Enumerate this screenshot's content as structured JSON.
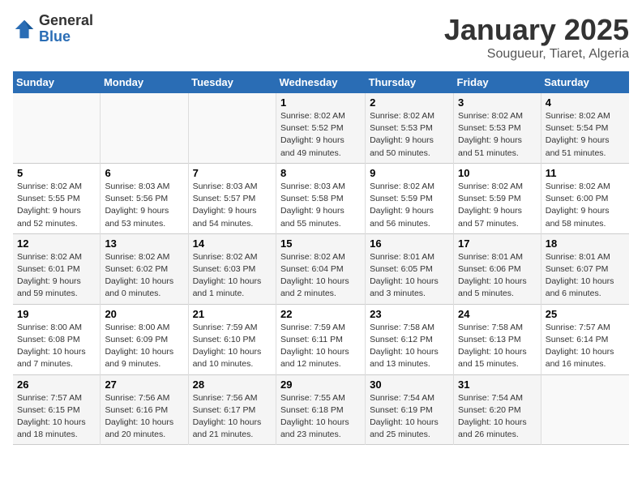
{
  "header": {
    "logo_general": "General",
    "logo_blue": "Blue",
    "calendar_title": "January 2025",
    "calendar_subtitle": "Sougueur, Tiaret, Algeria"
  },
  "weekdays": [
    "Sunday",
    "Monday",
    "Tuesday",
    "Wednesday",
    "Thursday",
    "Friday",
    "Saturday"
  ],
  "weeks": [
    [
      null,
      null,
      null,
      {
        "day": 1,
        "sunrise": "8:02 AM",
        "sunset": "5:52 PM",
        "daylight": "9 hours and 49 minutes."
      },
      {
        "day": 2,
        "sunrise": "8:02 AM",
        "sunset": "5:53 PM",
        "daylight": "9 hours and 50 minutes."
      },
      {
        "day": 3,
        "sunrise": "8:02 AM",
        "sunset": "5:53 PM",
        "daylight": "9 hours and 51 minutes."
      },
      {
        "day": 4,
        "sunrise": "8:02 AM",
        "sunset": "5:54 PM",
        "daylight": "9 hours and 51 minutes."
      }
    ],
    [
      {
        "day": 5,
        "sunrise": "8:02 AM",
        "sunset": "5:55 PM",
        "daylight": "9 hours and 52 minutes."
      },
      {
        "day": 6,
        "sunrise": "8:03 AM",
        "sunset": "5:56 PM",
        "daylight": "9 hours and 53 minutes."
      },
      {
        "day": 7,
        "sunrise": "8:03 AM",
        "sunset": "5:57 PM",
        "daylight": "9 hours and 54 minutes."
      },
      {
        "day": 8,
        "sunrise": "8:03 AM",
        "sunset": "5:58 PM",
        "daylight": "9 hours and 55 minutes."
      },
      {
        "day": 9,
        "sunrise": "8:02 AM",
        "sunset": "5:59 PM",
        "daylight": "9 hours and 56 minutes."
      },
      {
        "day": 10,
        "sunrise": "8:02 AM",
        "sunset": "5:59 PM",
        "daylight": "9 hours and 57 minutes."
      },
      {
        "day": 11,
        "sunrise": "8:02 AM",
        "sunset": "6:00 PM",
        "daylight": "9 hours and 58 minutes."
      }
    ],
    [
      {
        "day": 12,
        "sunrise": "8:02 AM",
        "sunset": "6:01 PM",
        "daylight": "9 hours and 59 minutes."
      },
      {
        "day": 13,
        "sunrise": "8:02 AM",
        "sunset": "6:02 PM",
        "daylight": "10 hours and 0 minutes."
      },
      {
        "day": 14,
        "sunrise": "8:02 AM",
        "sunset": "6:03 PM",
        "daylight": "10 hours and 1 minute."
      },
      {
        "day": 15,
        "sunrise": "8:02 AM",
        "sunset": "6:04 PM",
        "daylight": "10 hours and 2 minutes."
      },
      {
        "day": 16,
        "sunrise": "8:01 AM",
        "sunset": "6:05 PM",
        "daylight": "10 hours and 3 minutes."
      },
      {
        "day": 17,
        "sunrise": "8:01 AM",
        "sunset": "6:06 PM",
        "daylight": "10 hours and 5 minutes."
      },
      {
        "day": 18,
        "sunrise": "8:01 AM",
        "sunset": "6:07 PM",
        "daylight": "10 hours and 6 minutes."
      }
    ],
    [
      {
        "day": 19,
        "sunrise": "8:00 AM",
        "sunset": "6:08 PM",
        "daylight": "10 hours and 7 minutes."
      },
      {
        "day": 20,
        "sunrise": "8:00 AM",
        "sunset": "6:09 PM",
        "daylight": "10 hours and 9 minutes."
      },
      {
        "day": 21,
        "sunrise": "7:59 AM",
        "sunset": "6:10 PM",
        "daylight": "10 hours and 10 minutes."
      },
      {
        "day": 22,
        "sunrise": "7:59 AM",
        "sunset": "6:11 PM",
        "daylight": "10 hours and 12 minutes."
      },
      {
        "day": 23,
        "sunrise": "7:58 AM",
        "sunset": "6:12 PM",
        "daylight": "10 hours and 13 minutes."
      },
      {
        "day": 24,
        "sunrise": "7:58 AM",
        "sunset": "6:13 PM",
        "daylight": "10 hours and 15 minutes."
      },
      {
        "day": 25,
        "sunrise": "7:57 AM",
        "sunset": "6:14 PM",
        "daylight": "10 hours and 16 minutes."
      }
    ],
    [
      {
        "day": 26,
        "sunrise": "7:57 AM",
        "sunset": "6:15 PM",
        "daylight": "10 hours and 18 minutes."
      },
      {
        "day": 27,
        "sunrise": "7:56 AM",
        "sunset": "6:16 PM",
        "daylight": "10 hours and 20 minutes."
      },
      {
        "day": 28,
        "sunrise": "7:56 AM",
        "sunset": "6:17 PM",
        "daylight": "10 hours and 21 minutes."
      },
      {
        "day": 29,
        "sunrise": "7:55 AM",
        "sunset": "6:18 PM",
        "daylight": "10 hours and 23 minutes."
      },
      {
        "day": 30,
        "sunrise": "7:54 AM",
        "sunset": "6:19 PM",
        "daylight": "10 hours and 25 minutes."
      },
      {
        "day": 31,
        "sunrise": "7:54 AM",
        "sunset": "6:20 PM",
        "daylight": "10 hours and 26 minutes."
      },
      null
    ]
  ],
  "labels": {
    "sunrise": "Sunrise:",
    "sunset": "Sunset:",
    "daylight": "Daylight:"
  }
}
